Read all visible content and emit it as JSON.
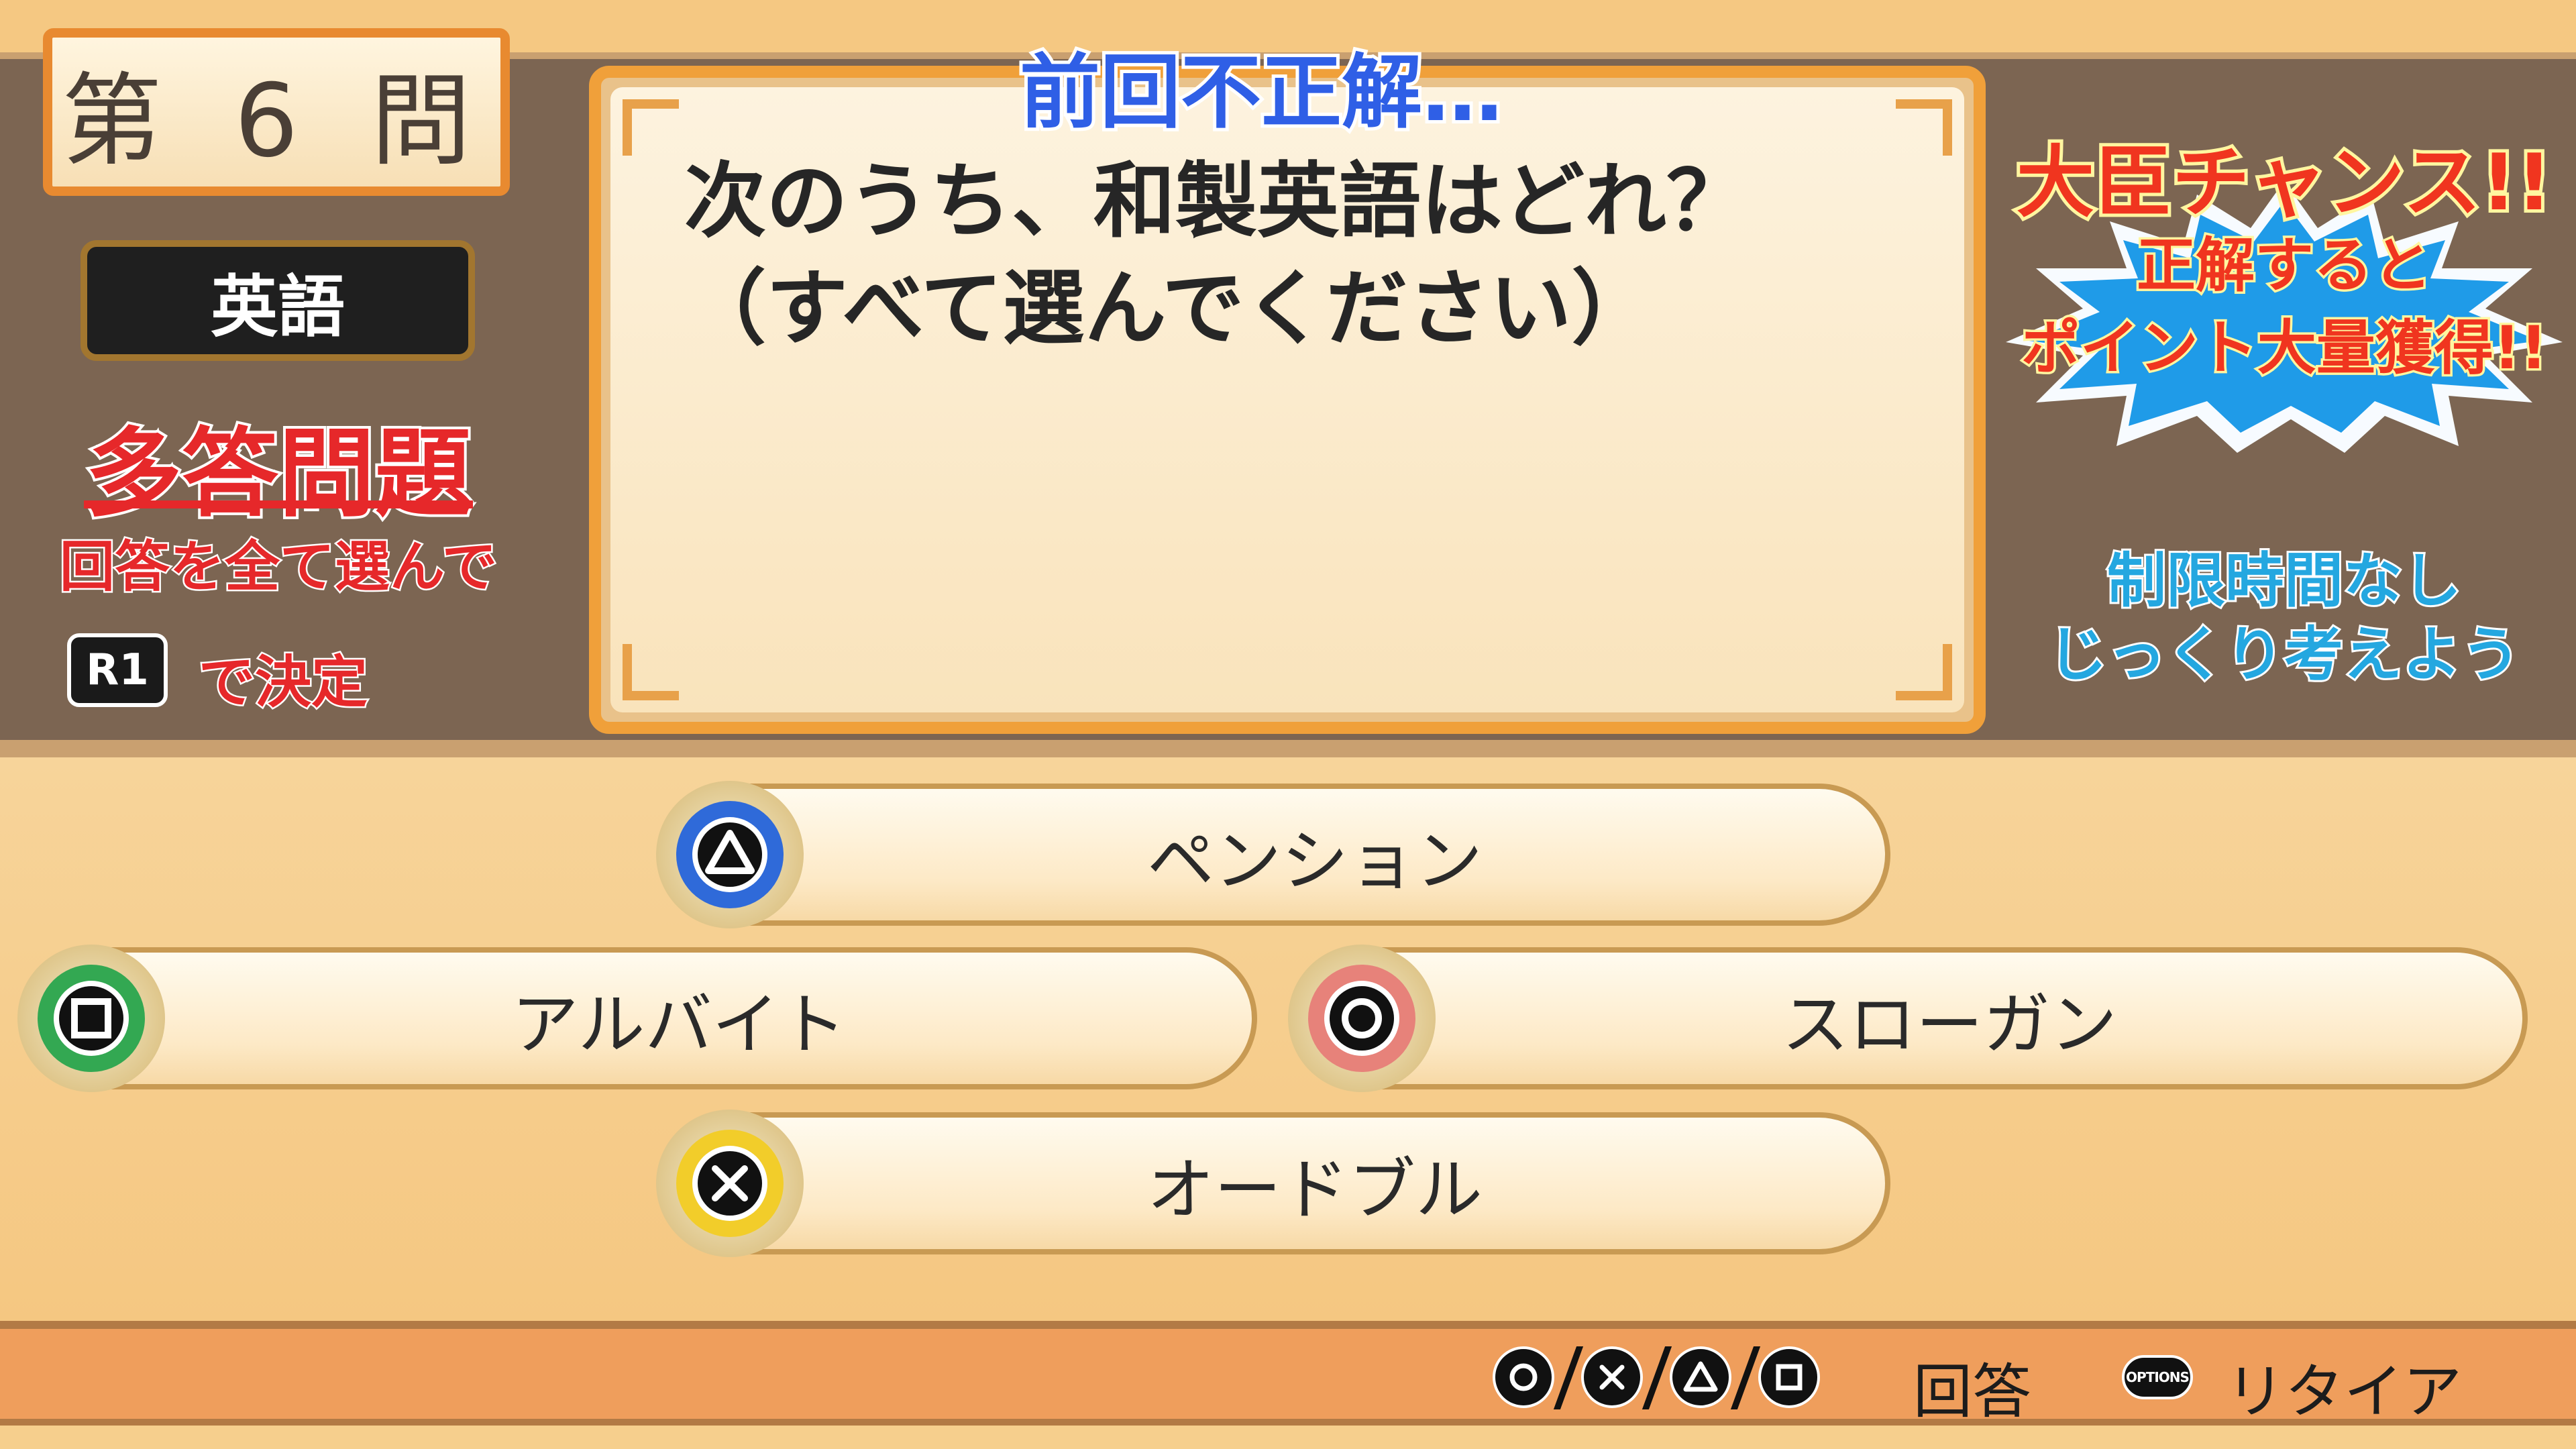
{
  "question_number": "第 6 問",
  "subject": "英語",
  "mode": {
    "title": "多答問題",
    "instruction": "回答を全て選んで",
    "confirm_button": "R1",
    "confirm_text": "で決定"
  },
  "previous_result": "前回不正解…",
  "question_text": "次のうち、和製英語はどれ？（すべて選んでください）",
  "minister_chance": {
    "title": "大臣チャンス!!",
    "line1": "正解すると",
    "line2": "ポイント大量獲得!!"
  },
  "time_limit": {
    "line1": "制限時間なし",
    "line2": "じっくり考えよう"
  },
  "answers": {
    "triangle": "ペンション",
    "square": "アルバイト",
    "circle": "スローガン",
    "cross": "オードブル"
  },
  "button_colors": {
    "triangle": "#2f6ad9",
    "square": "#33a852",
    "circle": "#e7827a",
    "cross": "#f2cd2a"
  },
  "footer": {
    "answer_label": "回答",
    "options_badge": "OPTIONS",
    "retire_label": "リタイア"
  }
}
